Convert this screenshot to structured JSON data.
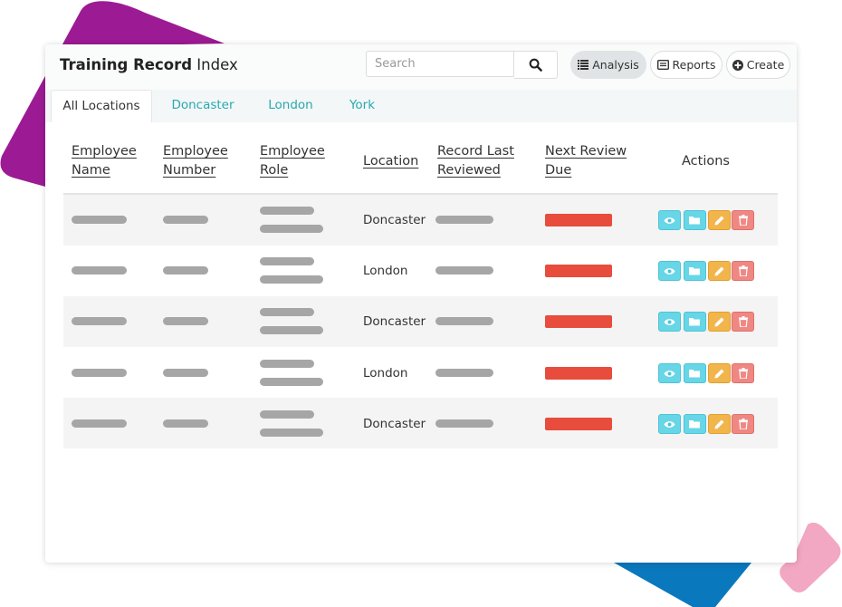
{
  "colors": {
    "accent_teal": "#2aa8b0",
    "overdue_red": "#e74c3c",
    "view_button": "#67d6e7",
    "edit_button": "#f2b54c",
    "delete_button": "#ef8883",
    "decor_purple": "#9c1b94",
    "decor_blue": "#0a78bd",
    "decor_pink": "#f2a7c2"
  },
  "header": {
    "title_bold": "Training Record",
    "title_rest": "Index",
    "search": {
      "placeholder": "Search",
      "icon": "search-icon"
    },
    "buttons": [
      {
        "label": "Analysis",
        "icon": "list-icon",
        "active": true
      },
      {
        "label": "Reports",
        "icon": "report-icon",
        "active": false
      },
      {
        "label": "Create",
        "icon": "plus-circle-icon",
        "active": false
      }
    ]
  },
  "tabs": [
    {
      "label": "All Locations",
      "active": true
    },
    {
      "label": "Doncaster",
      "active": false
    },
    {
      "label": "London",
      "active": false
    },
    {
      "label": "York",
      "active": false
    }
  ],
  "table": {
    "columns": {
      "employee_name": {
        "line1": "Employee",
        "line2": "Name"
      },
      "employee_number": {
        "line1": "Employee",
        "line2": "Number"
      },
      "employee_role": {
        "line1": "Employee",
        "line2": "Role"
      },
      "location": "Location",
      "record_last_reviewed": {
        "line1": "Record Last",
        "line2": "Reviewed"
      },
      "next_review_due": {
        "line1": "Next Review",
        "line2": "Due"
      },
      "actions": "Actions"
    },
    "rows": [
      {
        "location": "Doncaster"
      },
      {
        "location": "London"
      },
      {
        "location": "Doncaster"
      },
      {
        "location": "London"
      },
      {
        "location": "Doncaster"
      }
    ],
    "row_actions": [
      "eye-icon",
      "folder-icon",
      "pencil-icon",
      "trash-icon"
    ]
  }
}
